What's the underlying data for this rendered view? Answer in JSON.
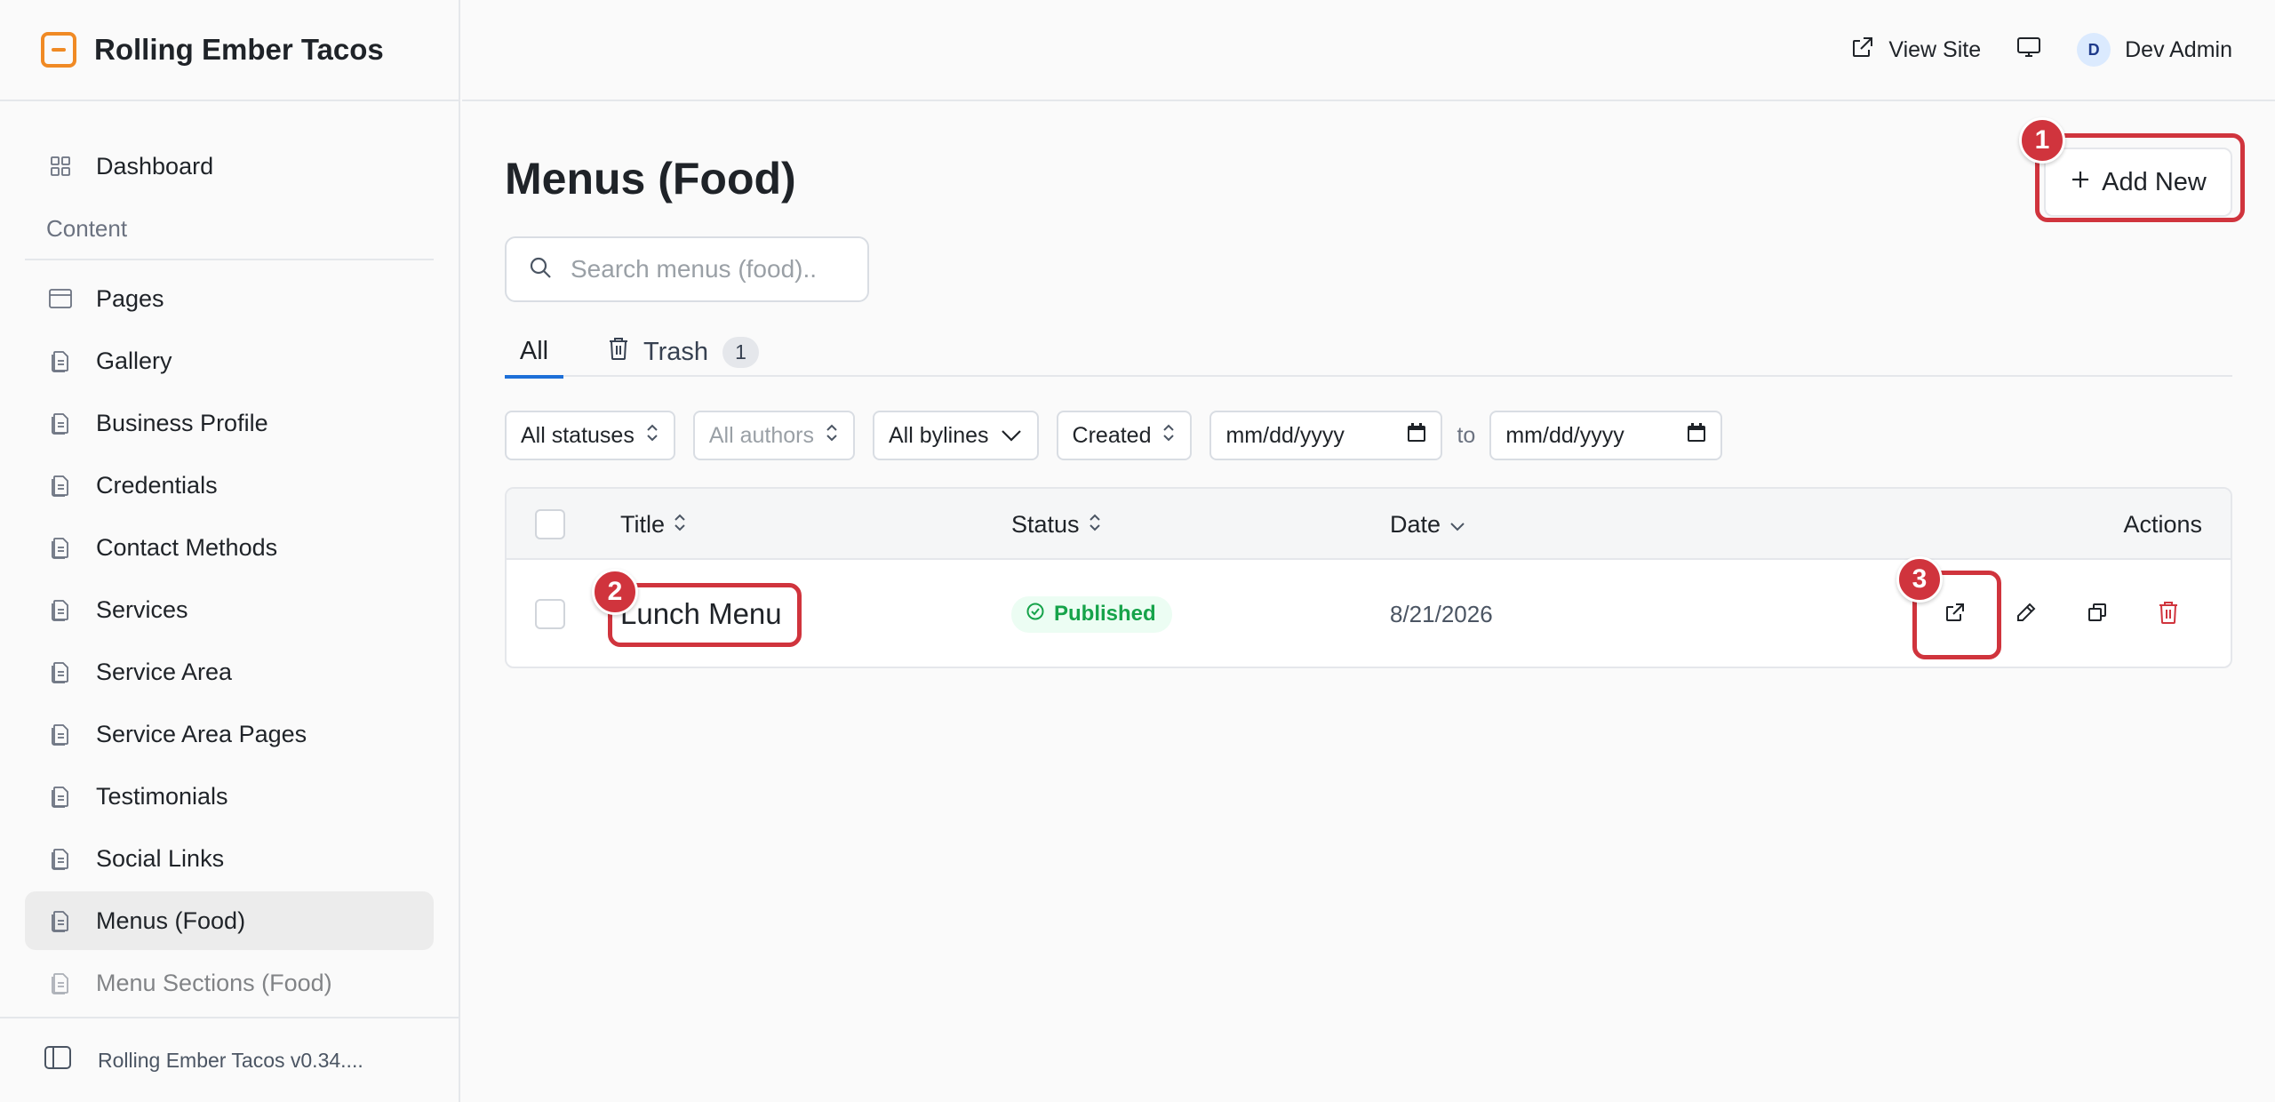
{
  "app": {
    "name": "Rolling Ember Tacos",
    "version_label": "Rolling Ember Tacos v0.34...."
  },
  "topbar": {
    "view_site": "View Site",
    "user_initial": "D",
    "user_name": "Dev Admin"
  },
  "sidebar": {
    "dashboard": "Dashboard",
    "section_label": "Content",
    "items": [
      {
        "label": "Pages",
        "icon": "layout-icon"
      },
      {
        "label": "Gallery",
        "icon": "document-icon"
      },
      {
        "label": "Business Profile",
        "icon": "document-icon"
      },
      {
        "label": "Credentials",
        "icon": "document-icon"
      },
      {
        "label": "Contact Methods",
        "icon": "document-icon"
      },
      {
        "label": "Services",
        "icon": "document-icon"
      },
      {
        "label": "Service Area",
        "icon": "document-icon"
      },
      {
        "label": "Service Area Pages",
        "icon": "document-icon"
      },
      {
        "label": "Testimonials",
        "icon": "document-icon"
      },
      {
        "label": "Social Links",
        "icon": "document-icon"
      },
      {
        "label": "Menus (Food)",
        "icon": "document-icon",
        "active": true
      },
      {
        "label": "Menu Sections (Food)",
        "icon": "document-icon"
      }
    ]
  },
  "main": {
    "title": "Menus (Food)",
    "add_new": "Add New",
    "search_placeholder": "Search menus (food)..",
    "tabs": {
      "all": "All",
      "trash": "Trash",
      "trash_count": "1"
    },
    "filters": {
      "statuses": "All statuses",
      "authors": "All authors",
      "bylines": "All bylines",
      "sort": "Created",
      "date_from": "mm/dd/yyyy",
      "to": "to",
      "date_to": "mm/dd/yyyy"
    },
    "table": {
      "headers": {
        "title": "Title",
        "status": "Status",
        "date": "Date",
        "actions": "Actions"
      },
      "rows": [
        {
          "title": "Lunch Menu",
          "status": "Published",
          "date": "8/21/2026"
        }
      ]
    }
  },
  "annotations": {
    "one": "1",
    "two": "2",
    "three": "3"
  },
  "colors": {
    "accent": "#1d6fd8",
    "brand": "#f08a24",
    "annotation": "#d0343d",
    "published": "#16a34a",
    "danger": "#d0343d"
  }
}
